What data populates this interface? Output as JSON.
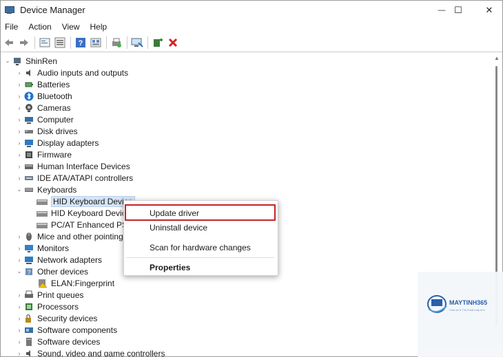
{
  "window": {
    "title": "Device Manager",
    "controls": {
      "minimize": "—",
      "maximize": "☐",
      "close": "✕"
    }
  },
  "menubar": [
    "File",
    "Action",
    "View",
    "Help"
  ],
  "toolbar": {
    "icons": [
      "back-icon",
      "forward-icon",
      "properties-icon",
      "device-list-icon",
      "help-icon",
      "view-icon",
      "print-icon",
      "scan-hardware-icon",
      "add-driver-icon",
      "uninstall-icon"
    ]
  },
  "tree": {
    "root": "ShinRen",
    "categories": [
      {
        "label": "Audio inputs and outputs",
        "icon": "speaker-icon",
        "expanded": false
      },
      {
        "label": "Batteries",
        "icon": "battery-icon",
        "expanded": false
      },
      {
        "label": "Bluetooth",
        "icon": "bluetooth-icon",
        "expanded": false
      },
      {
        "label": "Cameras",
        "icon": "camera-icon",
        "expanded": false
      },
      {
        "label": "Computer",
        "icon": "computer-icon",
        "expanded": false
      },
      {
        "label": "Disk drives",
        "icon": "disk-icon",
        "expanded": false
      },
      {
        "label": "Display adapters",
        "icon": "display-adapter-icon",
        "expanded": false
      },
      {
        "label": "Firmware",
        "icon": "firmware-icon",
        "expanded": false
      },
      {
        "label": "Human Interface Devices",
        "icon": "hid-icon",
        "expanded": false
      },
      {
        "label": "IDE ATA/ATAPI controllers",
        "icon": "ide-icon",
        "expanded": false
      },
      {
        "label": "Keyboards",
        "icon": "keyboard-icon",
        "expanded": true,
        "children": [
          "HID Keyboard Device",
          "HID Keyboard Device",
          "PC/AT Enhanced PS/2"
        ]
      },
      {
        "label": "Mice and other pointing",
        "icon": "mouse-icon",
        "expanded": false
      },
      {
        "label": "Monitors",
        "icon": "monitor-icon",
        "expanded": false
      },
      {
        "label": "Network adapters",
        "icon": "network-icon",
        "expanded": false
      },
      {
        "label": "Other devices",
        "icon": "unknown-device-icon",
        "expanded": true,
        "children": [
          "ELAN:Fingerprint"
        ]
      },
      {
        "label": "Print queues",
        "icon": "printer-icon",
        "expanded": false
      },
      {
        "label": "Processors",
        "icon": "processor-icon",
        "expanded": false
      },
      {
        "label": "Security devices",
        "icon": "security-icon",
        "expanded": false
      },
      {
        "label": "Software components",
        "icon": "software-component-icon",
        "expanded": false
      },
      {
        "label": "Software devices",
        "icon": "software-device-icon",
        "expanded": false
      },
      {
        "label": "Sound, video and game controllers",
        "icon": "sound-icon",
        "expanded": false
      }
    ]
  },
  "context_menu": {
    "items": [
      {
        "label": "Update driver",
        "highlighted": true
      },
      {
        "label": "Uninstall device",
        "highlighted": false
      },
      {
        "label": "Scan for hardware changes",
        "highlighted": false
      },
      {
        "label": "Properties",
        "bold": true
      }
    ],
    "highlight_color": "#c42227"
  },
  "watermark": {
    "brand": "MAYTINH365",
    "tagline": "Chia sẻ & Thủ thuật máy tính"
  },
  "colors": {
    "selection": "#d7e4f5",
    "accent": "#1e57a8"
  }
}
